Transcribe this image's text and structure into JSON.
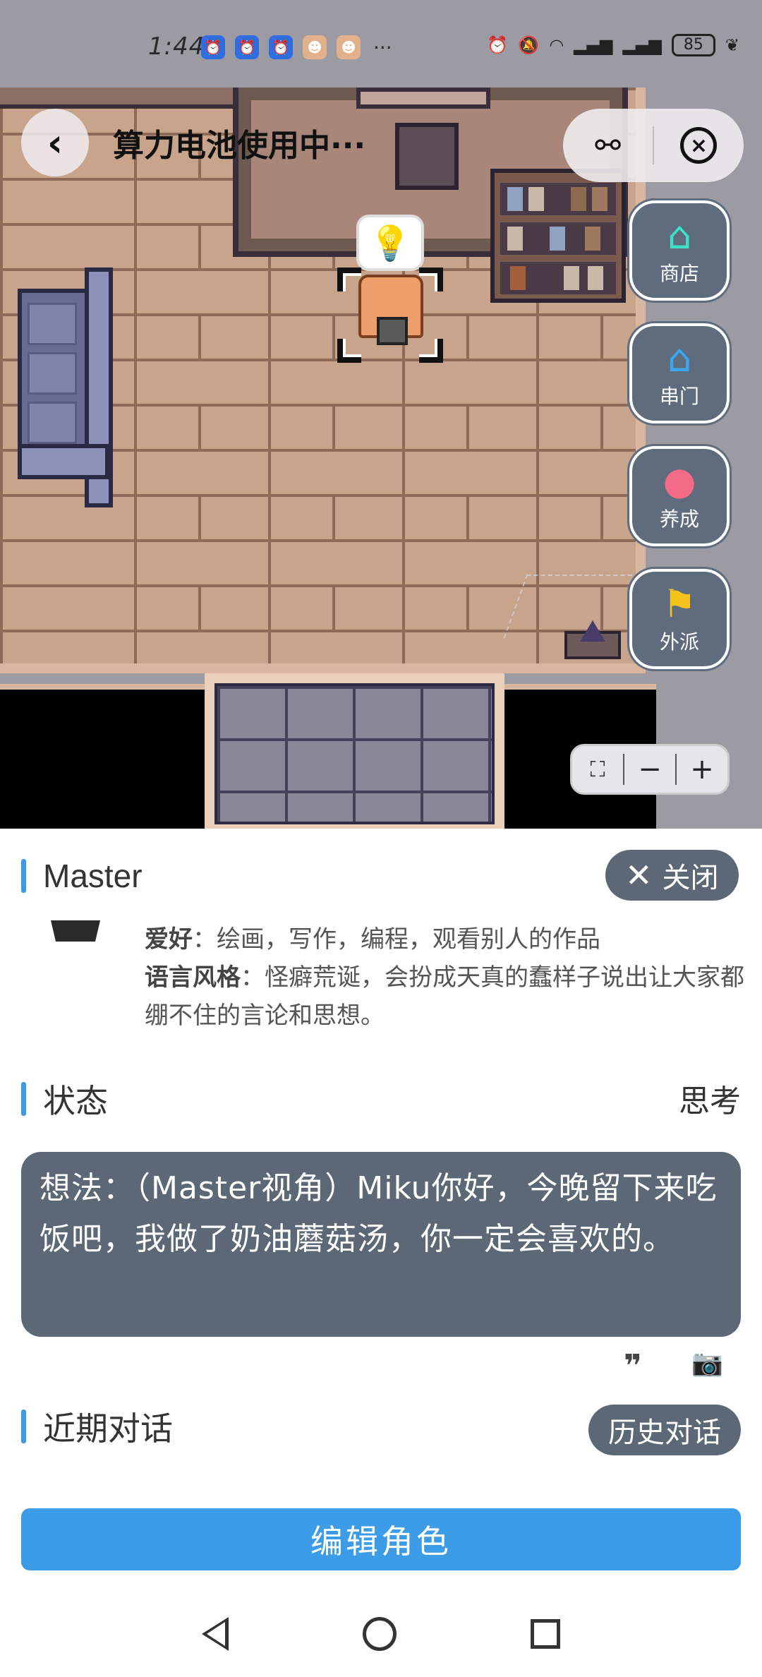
{
  "status_bar": {
    "time": "1:44",
    "notification_icons": [
      "alarm-app-icon",
      "alarm-app-icon",
      "alarm-app-icon",
      "game-app-icon",
      "game-app-icon"
    ],
    "more": "···",
    "battery": "85"
  },
  "scene": {
    "title": "算力电池使用中···",
    "bubble_icon": "lightbulb-icon"
  },
  "side_menu": [
    {
      "label": "商店",
      "icon": "shop-icon",
      "color": "#3ee0c8"
    },
    {
      "label": "串门",
      "icon": "house-heart-icon",
      "color": "#3aa8f0"
    },
    {
      "label": "养成",
      "icon": "paw-icon",
      "color": "#f36b86"
    },
    {
      "label": "外派",
      "icon": "flag-icon",
      "color": "#f5c21b"
    }
  ],
  "zoom": {
    "fit": "⛶",
    "minus": "−",
    "plus": "+"
  },
  "panel": {
    "name": "Master",
    "close_label": "关闭",
    "profile": {
      "hobby_key": "爱好",
      "hobby_value": "：绘画，写作，编程，观看别人的作品",
      "style_key": "语言风格",
      "style_value": "：怪癖荒诞，会扮成天真的蠢样子说出让大家都绷不住的言论和思想。"
    },
    "status_title": "状态",
    "status_value": "思考",
    "thought": "想法：（Master视角）Miku你好，今晚留下来吃饭吧，我做了奶油蘑菇汤，你一定会喜欢的。",
    "recent_title": "近期对话",
    "history_label": "历史对话",
    "edit_label": "编辑角色"
  },
  "colors": {
    "accent": "#3d9ce8",
    "panel_dark": "#5c6876"
  }
}
